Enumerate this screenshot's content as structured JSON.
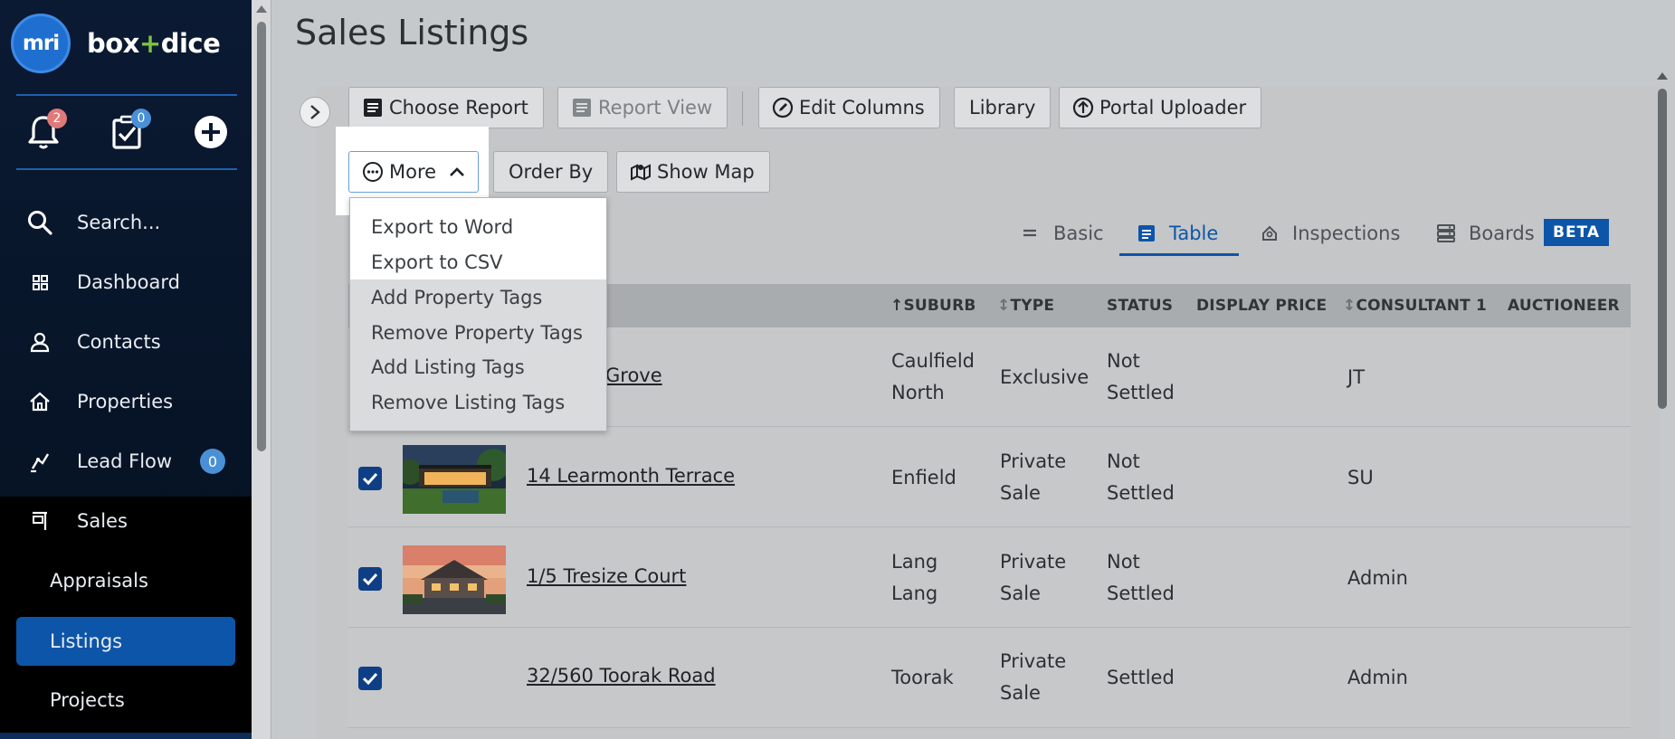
{
  "sidebar": {
    "logo_text": "mri",
    "brand_name_left": "box",
    "brand_name_plus": "+",
    "brand_name_right": "dice",
    "notifications_count": "2",
    "tasks_count": "0",
    "search_label": "Search...",
    "nav": {
      "dashboard": "Dashboard",
      "contacts": "Contacts",
      "properties": "Properties",
      "lead_flow": "Lead Flow",
      "lead_flow_count": "0",
      "sales": "Sales",
      "appraisals": "Appraisals",
      "listings": "Listings",
      "projects": "Projects"
    }
  },
  "page": {
    "title": "Sales Listings"
  },
  "toolbar": {
    "choose_report": "Choose Report",
    "report_view": "Report View",
    "edit_columns": "Edit Columns",
    "library": "Library",
    "portal_uploader": "Portal Uploader",
    "more": "More",
    "order_by": "Order By",
    "show_map": "Show Map"
  },
  "more_menu": {
    "items": [
      "Export to Word",
      "Export to CSV",
      "Add Property Tags",
      "Remove Property Tags",
      "Add Listing Tags",
      "Remove Listing Tags"
    ]
  },
  "view_tabs": {
    "basic": "Basic",
    "table": "Table",
    "inspections": "Inspections",
    "boards": "Boards",
    "beta": "BETA",
    "active": "Table"
  },
  "table": {
    "headers": {
      "suburb": "SUBURB",
      "type": "TYPE",
      "status": "STATUS",
      "display_price": "DISPLAY PRICE",
      "consultant1": "CONSULTANT 1",
      "auctioneer": "AUCTIONEER"
    },
    "rows": [
      {
        "address": "Grove",
        "suburb_l1": "Caulfield",
        "suburb_l2": "North",
        "type_l1": "Exclusive",
        "type_l2": "",
        "status_l1": "Not",
        "status_l2": "Settled",
        "consultant": "JT",
        "checked": true
      },
      {
        "address": "14 Learmonth Terrace",
        "suburb_l1": "Enfield",
        "suburb_l2": "",
        "type_l1": "Private",
        "type_l2": "Sale",
        "status_l1": "Not",
        "status_l2": "Settled",
        "consultant": "SU",
        "checked": true
      },
      {
        "address": "1/5 Tresize Court",
        "suburb_l1": "Lang",
        "suburb_l2": "Lang",
        "type_l1": "Private",
        "type_l2": "Sale",
        "status_l1": "Not",
        "status_l2": "Settled",
        "consultant": "Admin",
        "checked": true
      },
      {
        "address": "32/560 Toorak Road",
        "suburb_l1": "Toorak",
        "suburb_l2": "",
        "type_l1": "Private",
        "type_l2": "Sale",
        "status_l1": "Settled",
        "status_l2": "",
        "consultant": "Admin",
        "checked": true
      }
    ]
  },
  "colors": {
    "sidebar_bg": "#0b1a33",
    "accent_blue": "#0d55a8",
    "checkbox_blue": "#0e3f86",
    "notification_red": "#e07a7a",
    "brand_green": "#7cc242"
  }
}
